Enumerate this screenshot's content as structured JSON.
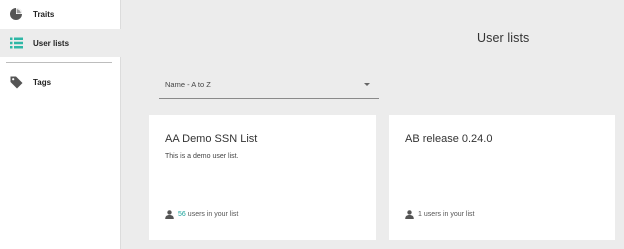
{
  "sidebar": {
    "items": [
      {
        "label": "Traits",
        "icon": "pie-chart-icon",
        "active": false
      },
      {
        "label": "User lists",
        "icon": "list-icon",
        "active": true
      },
      {
        "label": "Tags",
        "icon": "tag-icon",
        "active": false
      }
    ]
  },
  "main": {
    "title": "User lists",
    "sort": {
      "selected": "Name - A to Z",
      "icon": "dropdown-caret-icon"
    }
  },
  "cards": [
    {
      "title": "AA Demo SSN List",
      "description": "This is a demo user list.",
      "count": "56",
      "count_suffix": "users in your list",
      "icon": "person-icon"
    },
    {
      "title": "AB release 0.24.0",
      "description": "",
      "count": "1",
      "count_suffix": "users in your list",
      "icon": "person-icon"
    }
  ],
  "colors": {
    "accent": "#1aa39b",
    "list_icon": "#2fb7a6",
    "background": "#ececec",
    "card": "#ffffff"
  }
}
